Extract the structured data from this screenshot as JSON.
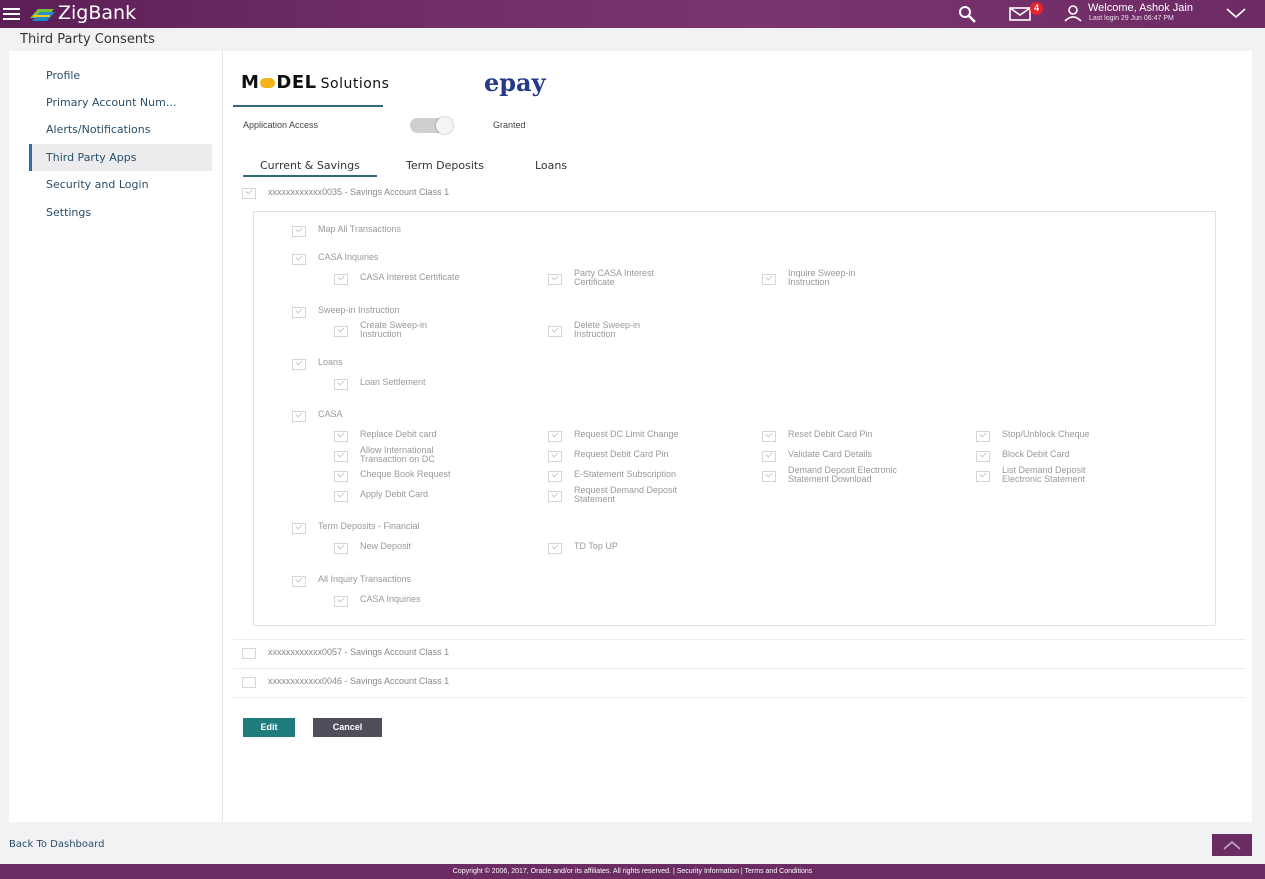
{
  "header": {
    "brand": "ZigBank",
    "notification_count": "4",
    "welcome": "Welcome, Ashok Jain",
    "last_login": "Last login 29 Jun 06:47 PM"
  },
  "page_title": "Third Party Consents",
  "sidebar": {
    "items": [
      {
        "label": "Profile"
      },
      {
        "label": "Primary Account Num..."
      },
      {
        "label": "Alerts/Notifications"
      },
      {
        "label": "Third Party Apps",
        "active": true
      },
      {
        "label": "Security and Login"
      },
      {
        "label": "Settings"
      }
    ]
  },
  "apps": {
    "model_logo_a": "M",
    "model_logo_b": "DEL",
    "model_logo_sub": "Solutions",
    "epay_logo": "epay"
  },
  "application_access": {
    "label": "Application Access",
    "value": "Granted",
    "enabled": true
  },
  "tabs": [
    {
      "label": "Current & Savings",
      "active": true
    },
    {
      "label": "Term Deposits"
    },
    {
      "label": "Loans"
    }
  ],
  "accounts": [
    {
      "label": "xxxxxxxxxxxx0035 - Savings Account Class 1",
      "checked": true
    },
    {
      "label": "xxxxxxxxxxxx0057 - Savings Account Class 1",
      "checked": false
    },
    {
      "label": "xxxxxxxxxxxx0046 - Savings Account Class 1",
      "checked": false
    }
  ],
  "permissions": {
    "map_all": "Map All Transactions",
    "casa_inquiries": {
      "title": "CASA Inquiries",
      "items": [
        "CASA Interest Certificate",
        "Party CASA Interest\nCertificate",
        "Inquire Sweep-in\nInstruction"
      ]
    },
    "sweep_in": {
      "title": "Sweep-in Instruction",
      "items": [
        "Create Sweep-in\nInstruction",
        "Delete Sweep-in\nInstruction"
      ]
    },
    "loans": {
      "title": "Loans",
      "items": [
        "Loan Settlement"
      ]
    },
    "casa": {
      "title": "CASA",
      "items": [
        "Replace Debit card",
        "Request DC Limit Change",
        "Reset Debit Card Pin",
        "Stop/Unblock Cheque",
        "Allow International\nTransaction on DC",
        "Request Debit Card Pin",
        "Validate Card Details",
        "Block Debit Card",
        "Cheque Book Request",
        "E-Statement Subscription",
        "Demand Deposit Electronic\nStatement Download",
        "List Demand Deposit\nElectronic Statement",
        "Apply Debit Card",
        "Request Demand Deposit\nStatement"
      ]
    },
    "td_financial": {
      "title": "Term Deposits - Financial",
      "items": [
        "New Deposit",
        "TD Top UP"
      ]
    },
    "all_inquiry": {
      "title": "All Inquiry Transactions",
      "items": [
        "CASA Inquiries"
      ]
    }
  },
  "buttons": {
    "edit": "Edit",
    "cancel": "Cancel"
  },
  "back_link": "Back To Dashboard",
  "footer": "Copyright © 2006, 2017, Oracle and/or its affiliates. All rights reserved. | Security Information | Terms and Conditions"
}
